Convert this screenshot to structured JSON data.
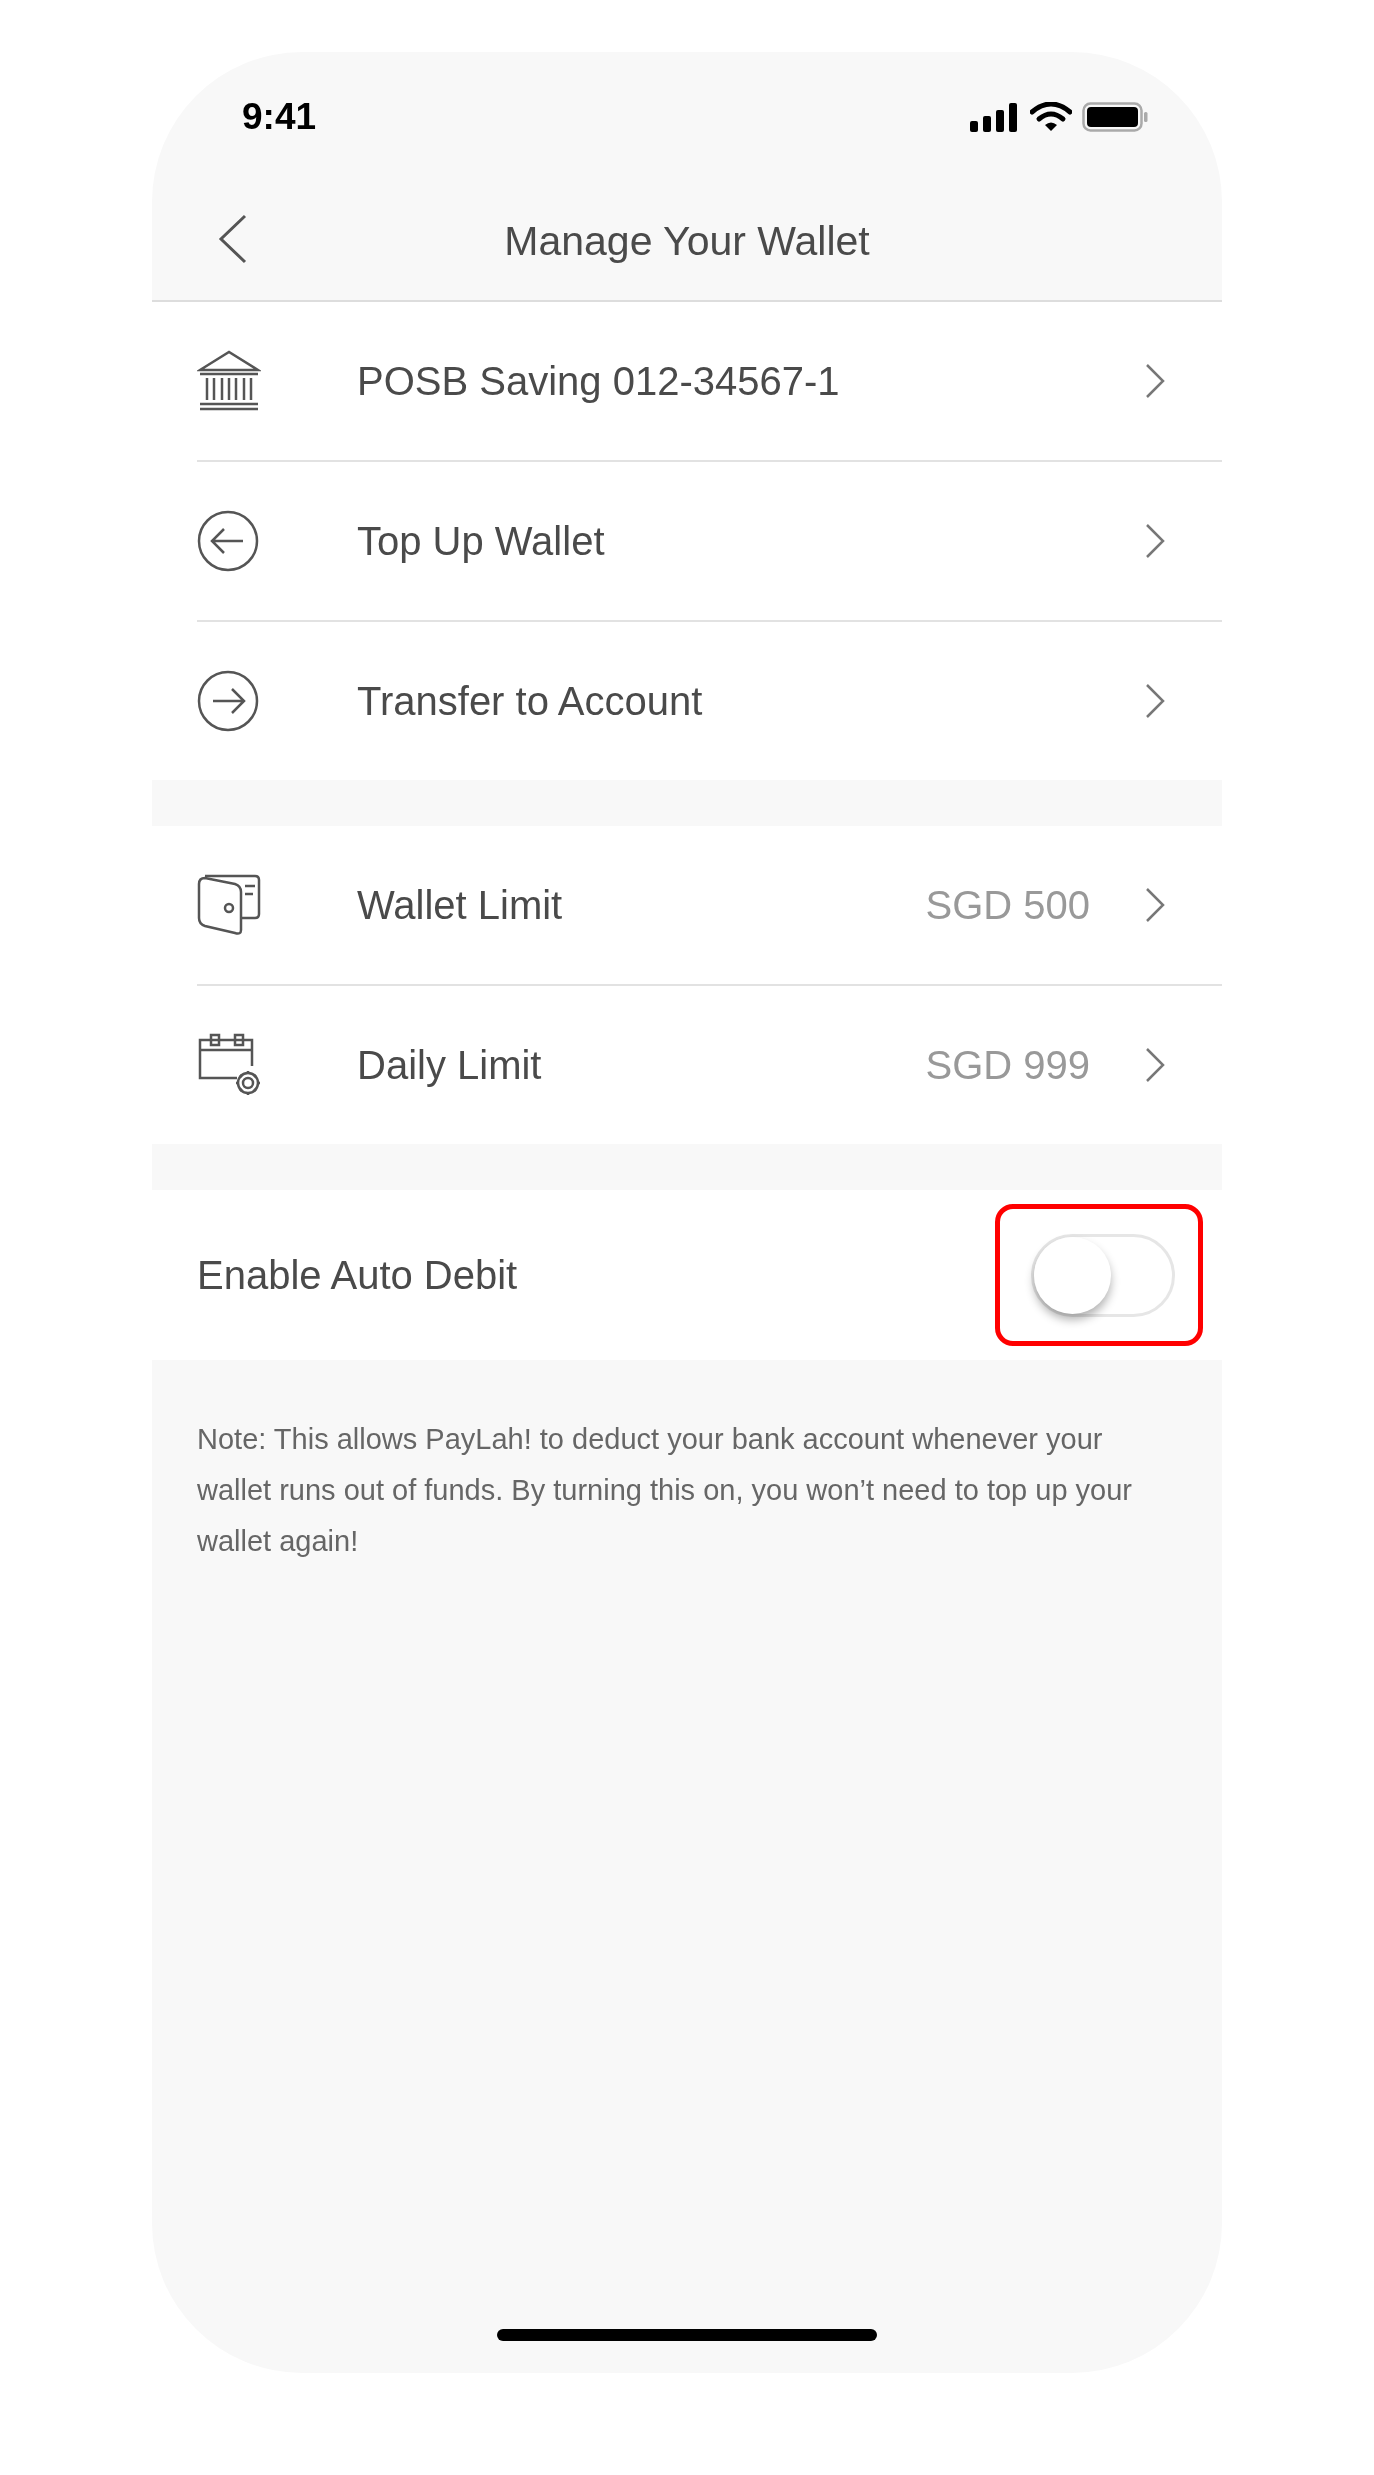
{
  "status_bar": {
    "time": "9:41"
  },
  "nav": {
    "title": "Manage Your Wallet"
  },
  "sections": [
    {
      "rows": [
        {
          "label": "POSB Saving 012-34567-1"
        },
        {
          "label": "Top Up Wallet"
        },
        {
          "label": "Transfer to Account"
        }
      ]
    },
    {
      "rows": [
        {
          "label": "Wallet Limit",
          "value": "SGD 500"
        },
        {
          "label": "Daily Limit",
          "value": "SGD 999"
        }
      ]
    }
  ],
  "auto_debit": {
    "label": "Enable Auto Debit",
    "on": false,
    "highlighted": true
  },
  "note": "Note: This allows PayLah! to deduct your bank account whenever your wallet runs out of funds. By turning this on, you won’t need to top up your wallet again!"
}
